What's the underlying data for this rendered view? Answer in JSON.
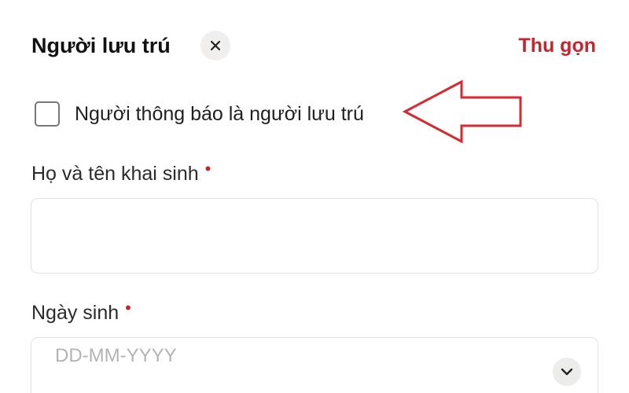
{
  "header": {
    "title": "Người lưu trú",
    "collapse_label": "Thu gọn",
    "close_icon": "close-icon"
  },
  "notifier_checkbox": {
    "label": "Người thông báo là người lưu trú",
    "checked": false
  },
  "annotation": {
    "arrow_color": "#d42a30"
  },
  "fields": {
    "full_name": {
      "label": "Họ và tên khai sinh",
      "required_marker": "•",
      "value": "",
      "placeholder": ""
    },
    "birth_date": {
      "label": "Ngày sinh",
      "required_marker": "•",
      "value": "",
      "placeholder": "DD-MM-YYYY",
      "dropdown_icon": "chevron-down-icon"
    }
  },
  "colors": {
    "accent": "#c4262e",
    "border": "#e2e2e2",
    "placeholder": "#b3b3b3"
  }
}
